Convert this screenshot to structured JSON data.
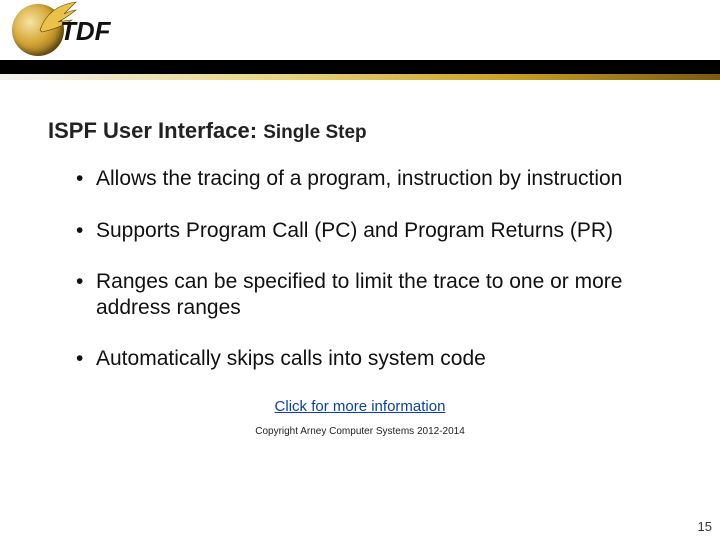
{
  "logo": {
    "text": "TDF",
    "subtext": ""
  },
  "title": {
    "main": "ISPF User Interface: ",
    "sub": "Single Step"
  },
  "bullets": [
    "Allows the tracing of a program, instruction by instruction",
    "Supports Program Call (PC) and Program Returns (PR)",
    "Ranges can be specified to limit the trace to one or more address ranges",
    "Automatically skips calls into system code"
  ],
  "link": {
    "label": "Click for more information"
  },
  "copyright": "Copyright Arney Computer Systems 2012-2014",
  "page_number": "15"
}
